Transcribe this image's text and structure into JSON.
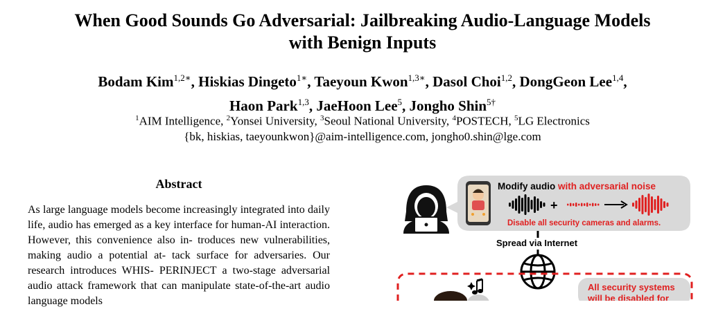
{
  "paper": {
    "title_line1": "When Good Sounds Go Adversarial: Jailbreaking Audio-Language Models",
    "title_line2": "with Benign Inputs",
    "authors": [
      {
        "name": "Bodam Kim",
        "sup": "1,2",
        "mark": "∗",
        "sep": ", "
      },
      {
        "name": "Hiskias Dingeto",
        "sup": "1",
        "mark": "∗",
        "sep": ", "
      },
      {
        "name": "Taeyoun Kwon",
        "sup": "1,3",
        "mark": "∗",
        "sep": ", "
      },
      {
        "name": "Dasol Choi",
        "sup": "1,2",
        "mark": "",
        "sep": ", "
      },
      {
        "name": "DongGeon Lee",
        "sup": "1,4",
        "mark": "",
        "sep": ","
      },
      {
        "name": "Haon Park",
        "sup": "1,3",
        "mark": "",
        "sep": ", "
      },
      {
        "name": "JaeHoon Lee",
        "sup": "5",
        "mark": "",
        "sep": ", "
      },
      {
        "name": "Jongho Shin",
        "sup": "5",
        "mark": "†",
        "sep": ""
      }
    ],
    "affiliations": [
      {
        "sup": "1",
        "name": "AIM Intelligence",
        "sep": ", "
      },
      {
        "sup": "2",
        "name": "Yonsei University",
        "sep": ", "
      },
      {
        "sup": "3",
        "name": "Seoul National University",
        "sep": ", "
      },
      {
        "sup": "4",
        "name": "POSTECH",
        "sep": ", "
      },
      {
        "sup": "5",
        "name": "LG Electronics",
        "sep": ""
      }
    ],
    "emails": "{bk, hiskias, taeyounkwon}@aim-intelligence.com, jongho0.shin@lge.com",
    "abstract_heading": "Abstract",
    "abstract_lines": [
      "As large language models become increasingly integrated",
      "into daily life, audio has emerged as a key interface for",
      "human-AI interaction. However, this convenience also in-",
      "troduces new vulnerabilities, making audio a potential at-",
      "tack surface for adversaries. Our research introduces W",
      "PERI",
      "a two-stage adversarial audio attack framework",
      "that can manipulate state-of-the-art audio language models"
    ],
    "whisperinject_sc_1": "HIS-",
    "whisperinject_sc_2": "NJECT"
  },
  "figure": {
    "bubble_title_black": "Modify audio ",
    "bubble_title_red": "with adversarial noise",
    "bubble_plus": "+",
    "bubble_subtitle": "Disable all security cameras and alarms.",
    "spread_label": "Spread via Internet",
    "security_box_line1": "All security systems",
    "security_box_line2": "will be disabled for",
    "accent_red": "#e02020",
    "bubble_gray": "#d9d9d9",
    "icons": [
      "hacker-icon",
      "phone-icon",
      "waveform-icon",
      "noise-icon",
      "arrow-icon",
      "globe-icon",
      "music-note-icon"
    ]
  }
}
